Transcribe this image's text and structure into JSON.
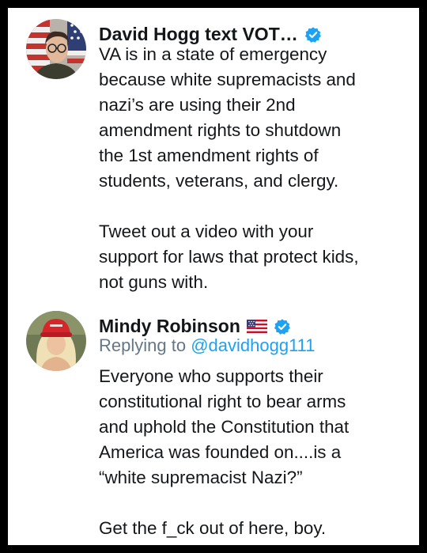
{
  "tweets": [
    {
      "display_name": "David Hogg text VOT…",
      "verified": true,
      "avatar_icon": "person-with-flag-avatar",
      "body": "VA is in a state of emergency\nbecause white supremacists and\nnazi’s are using their 2nd\namendment rights to shutdown\nthe 1st amendment rights of\nstudents, veterans, and clergy.\n\nTweet out a video with your\nsupport for laws that protect kids,\nnot guns with."
    },
    {
      "display_name": "Mindy Robinson",
      "flag_icon": "us-flag-emoji",
      "verified": true,
      "avatar_icon": "woman-red-hat-avatar",
      "reply_prefix": "Replying to",
      "reply_handle": "@davidhogg111",
      "body": "Everyone who supports their\nconstitutional right to bear arms\nand uphold the Constitution that\nAmerica was founded on....is a\n“white supremacist Nazi?”\n\nGet the f_ck out of here, boy."
    }
  ],
  "colors": {
    "frame": "#000000",
    "background": "#ffffff",
    "text": "#14171a",
    "secondary_text": "#657786",
    "link": "#1da1f2",
    "verified_badge": "#1da1f2"
  }
}
